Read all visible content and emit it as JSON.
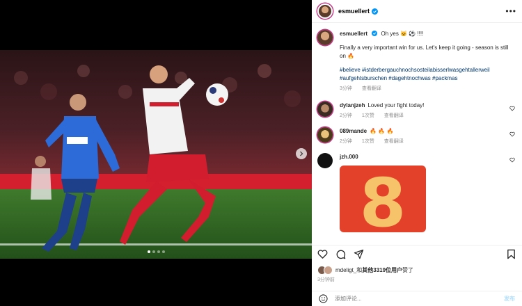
{
  "post": {
    "username": "esmuellert",
    "more_label": "•••"
  },
  "caption": {
    "username": "esmuellert",
    "line1": "Oh yes 🐱 ⚽ !!!!",
    "body": "Finally a very important win for us. Let's keep it going - season is still on 🔥",
    "hashtags": "#believe #istderbergauchnochsosteilabisserlwasgehtallerweil #aufgehtsburschen #dagehtnochwas #packmas",
    "time": "3分钟",
    "translate": "查看翻译"
  },
  "comments": [
    {
      "username": "dylanjzeh",
      "text": "Loved your fight today!",
      "time": "2分钟",
      "likes": "1次赞",
      "translate": "查看翻译"
    },
    {
      "username": "089mande",
      "text": "🔥 🔥 🔥",
      "time": "2分钟",
      "likes": "1次赞",
      "translate": "查看翻译"
    },
    {
      "username": "jzh.000",
      "image_number": "8"
    }
  ],
  "likes": {
    "prefix": "mdeligt_和",
    "bold": "其他3319位用户",
    "suffix": "赞了"
  },
  "timestamp": "3分钟前",
  "add_comment": {
    "placeholder": "添加评论...",
    "post_label": "发布"
  },
  "colors": {
    "link": "#00376b",
    "verified": "#0095f6",
    "meta": "#8e8e8e"
  }
}
